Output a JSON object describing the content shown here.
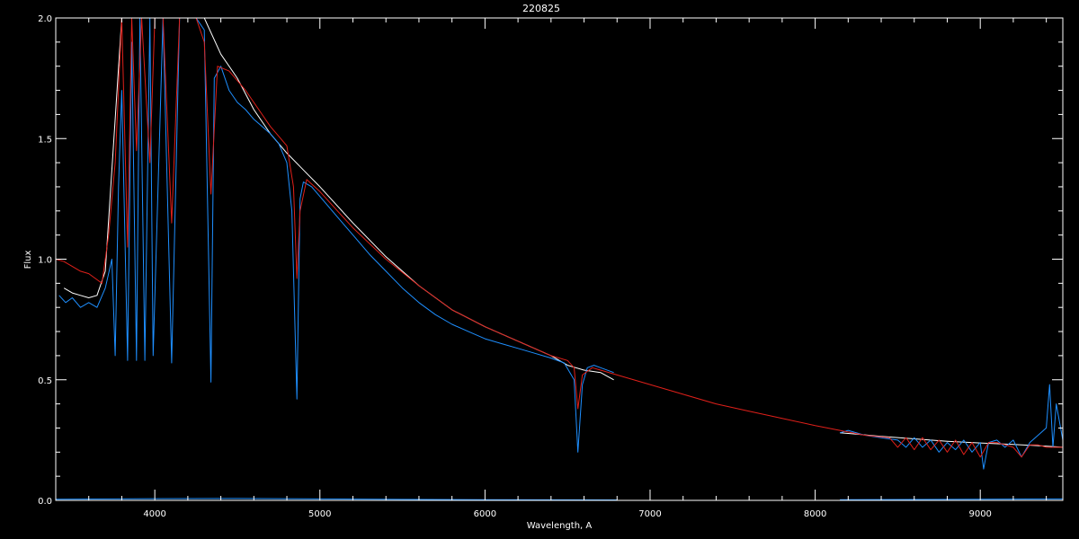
{
  "chart_data": {
    "type": "line",
    "title": "220825",
    "xlabel": "Wavelength, A",
    "ylabel": "Flux",
    "xlim": [
      3400,
      9500
    ],
    "ylim": [
      0.0,
      2.0
    ],
    "x_ticks": [
      4000,
      5000,
      6000,
      7000,
      8000,
      9000
    ],
    "x_tick_labels": [
      "4000",
      "5000",
      "6000",
      "7000",
      "8000",
      "9000"
    ],
    "y_ticks": [
      0.0,
      0.5,
      1.0,
      1.5,
      2.0
    ],
    "y_tick_labels": [
      "0.0",
      "0.5",
      "1.0",
      "1.5",
      "2.0"
    ],
    "x_minor_step": 200,
    "y_minor_step": 0.1,
    "grid": false,
    "colors": {
      "background": "#000000",
      "axes": "#ffffff",
      "model": "#e0201a",
      "observed_blue": "#1e8fff",
      "observed_white": "#ffffff",
      "error": "#1e8fff"
    },
    "series": [
      {
        "key": "observed_white",
        "color": "#ffffff",
        "segments": [
          {
            "x": [
              3450,
              3500,
              3550,
              3600,
              3650,
              3700,
              3800,
              3900,
              4000,
              4100,
              4200,
              4300,
              4400,
              4500,
              4600,
              4700,
              4800,
              4900,
              5000,
              5200,
              5400,
              5600,
              5800,
              6000,
              6200,
              6400,
              6500,
              6600,
              6700,
              6780
            ],
            "y": [
              0.88,
              0.86,
              0.85,
              0.84,
              0.85,
              0.95,
              2.0,
              2.0,
              2.0,
              2.0,
              2.0,
              2.0,
              1.85,
              1.75,
              1.62,
              1.52,
              1.44,
              1.37,
              1.3,
              1.15,
              1.01,
              0.89,
              0.79,
              0.72,
              0.66,
              0.6,
              0.56,
              0.54,
              0.53,
              0.5
            ]
          },
          {
            "x": [
              8150,
              8250,
              8400,
              8600,
              8800,
              9000,
              9200,
              9400,
              9500
            ],
            "y": [
              0.28,
              0.275,
              0.265,
              0.255,
              0.245,
              0.238,
              0.232,
              0.225,
              0.22
            ]
          }
        ]
      },
      {
        "key": "observed_blue",
        "color": "#1e8fff",
        "segments": [
          {
            "x": [
              3420,
              3460,
              3500,
              3550,
              3600,
              3650,
              3700,
              3740,
              3760,
              3780,
              3800,
              3835,
              3860,
              3889,
              3910,
              3940,
              3970,
              3990,
              4050,
              4102,
              4150,
              4200,
              4250,
              4300,
              4340,
              4360,
              4400,
              4450,
              4500,
              4550,
              4600,
              4650,
              4700,
              4750,
              4800,
              4830,
              4861,
              4880,
              4900,
              4950,
              5000,
              5100,
              5200,
              5300,
              5400,
              5500,
              5600,
              5700,
              5800,
              5900,
              6000,
              6100,
              6200,
              6300,
              6400,
              6480,
              6540,
              6563,
              6590,
              6620,
              6660,
              6700,
              6780
            ],
            "y": [
              0.85,
              0.82,
              0.84,
              0.8,
              0.82,
              0.8,
              0.88,
              1.0,
              0.6,
              1.3,
              1.7,
              0.58,
              1.9,
              0.58,
              2.0,
              0.58,
              2.0,
              0.6,
              2.0,
              0.57,
              2.0,
              2.0,
              2.0,
              1.95,
              0.49,
              1.75,
              1.8,
              1.7,
              1.65,
              1.62,
              1.58,
              1.55,
              1.52,
              1.48,
              1.4,
              1.2,
              0.42,
              1.25,
              1.32,
              1.3,
              1.26,
              1.18,
              1.1,
              1.02,
              0.95,
              0.88,
              0.82,
              0.77,
              0.73,
              0.7,
              0.67,
              0.65,
              0.63,
              0.61,
              0.59,
              0.57,
              0.5,
              0.2,
              0.48,
              0.55,
              0.56,
              0.55,
              0.53
            ]
          },
          {
            "x": [
              8150,
              8200,
              8300,
              8400,
              8500,
              8550,
              8600,
              8650,
              8700,
              8750,
              8800,
              8850,
              8900,
              8950,
              9000,
              9020,
              9050,
              9100,
              9150,
              9200,
              9250,
              9300,
              9350,
              9400,
              9420,
              9440,
              9460,
              9500
            ],
            "y": [
              0.28,
              0.29,
              0.27,
              0.26,
              0.25,
              0.22,
              0.26,
              0.22,
              0.25,
              0.2,
              0.24,
              0.21,
              0.25,
              0.2,
              0.24,
              0.13,
              0.24,
              0.25,
              0.22,
              0.25,
              0.18,
              0.24,
              0.27,
              0.3,
              0.48,
              0.22,
              0.4,
              0.25
            ]
          }
        ]
      },
      {
        "key": "model",
        "color": "#e0201a",
        "segments": [
          {
            "x": [
              3400,
              3450,
              3500,
              3550,
              3600,
              3640,
              3680,
              3720,
              3760,
              3800,
              3835,
              3860,
              3889,
              3920,
              3970,
              4000,
              4050,
              4102,
              4150,
              4200,
              4250,
              4300,
              4340,
              4380,
              4450,
              4500,
              4550,
              4600,
              4650,
              4700,
              4750,
              4800,
              4840,
              4861,
              4880,
              4920,
              5000,
              5200,
              5400,
              5600,
              5800,
              6000,
              6200,
              6400,
              6500,
              6540,
              6563,
              6590,
              6650,
              6700,
              6800,
              7000,
              7200,
              7400,
              7600,
              7800,
              8000,
              8150,
              8300,
              8450,
              8500,
              8550,
              8600,
              8650,
              8700,
              8750,
              8800,
              8850,
              8900,
              8950,
              9000,
              9050,
              9100,
              9150,
              9200,
              9250,
              9300,
              9350,
              9400,
              9450,
              9500
            ],
            "y": [
              1.0,
              0.99,
              0.97,
              0.95,
              0.94,
              0.92,
              0.9,
              1.1,
              1.4,
              2.0,
              1.05,
              2.0,
              1.45,
              2.0,
              1.4,
              2.0,
              2.0,
              1.15,
              2.0,
              2.0,
              2.0,
              1.9,
              1.27,
              1.8,
              1.78,
              1.74,
              1.7,
              1.65,
              1.6,
              1.55,
              1.51,
              1.47,
              1.3,
              0.92,
              1.2,
              1.33,
              1.28,
              1.13,
              1.0,
              0.89,
              0.79,
              0.72,
              0.66,
              0.6,
              0.58,
              0.55,
              0.38,
              0.52,
              0.55,
              0.54,
              0.52,
              0.48,
              0.44,
              0.4,
              0.37,
              0.34,
              0.31,
              0.29,
              0.27,
              0.26,
              0.22,
              0.26,
              0.21,
              0.26,
              0.21,
              0.25,
              0.2,
              0.25,
              0.19,
              0.24,
              0.18,
              0.24,
              0.24,
              0.23,
              0.22,
              0.18,
              0.23,
              0.23,
              0.22,
              0.22,
              0.22
            ]
          }
        ]
      },
      {
        "key": "error",
        "color": "#1e8fff",
        "segments": [
          {
            "x": [
              3400,
              4000,
              4500,
              5000,
              5500,
              6000,
              6800
            ],
            "y": [
              0.005,
              0.007,
              0.008,
              0.006,
              0.004,
              0.003,
              0.002
            ]
          },
          {
            "x": [
              8150,
              8800,
              9500
            ],
            "y": [
              0.003,
              0.004,
              0.006
            ]
          }
        ]
      }
    ]
  }
}
